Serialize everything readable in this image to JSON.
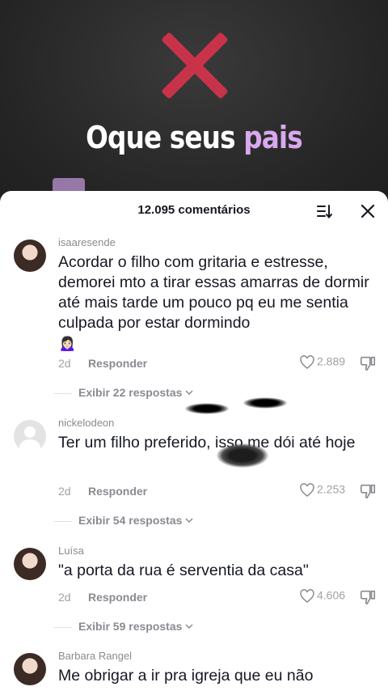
{
  "video": {
    "headline_main": "Oque seus ",
    "headline_accent": "pais",
    "accent_color": "#d9a8ef",
    "mark_color": "#c9334a"
  },
  "sheet": {
    "title": "12.095 comentários",
    "sort_icon": "sort-icon",
    "close_icon": "close-icon"
  },
  "comments": [
    {
      "username": "isaaresende",
      "text": "Acordar o filho com gritaria e estresse, demorei mto a tirar essas amarras de dormir até mais tarde um pouco pq eu me sentia culpada por estar dormindo",
      "emoji": "🙍🏻‍♀️",
      "time": "2d",
      "reply_label": "Responder",
      "likes": "2.889",
      "replies_label": "Exibir 22 respostas"
    },
    {
      "username": "nickelodeon",
      "text": "Ter um filho preferido, isso me dói até hoje",
      "time": "2d",
      "reply_label": "Responder",
      "likes": "2.253",
      "replies_label": "Exibir 54 respostas"
    },
    {
      "username": "Luísa",
      "text": "\"a porta da rua é serventia da casa\"",
      "time": "2d",
      "reply_label": "Responder",
      "likes": "4.606",
      "replies_label": "Exibir 59 respostas"
    },
    {
      "username": "Barbara Rangel",
      "text": "Me obrigar a ir pra igreja que eu não"
    }
  ]
}
